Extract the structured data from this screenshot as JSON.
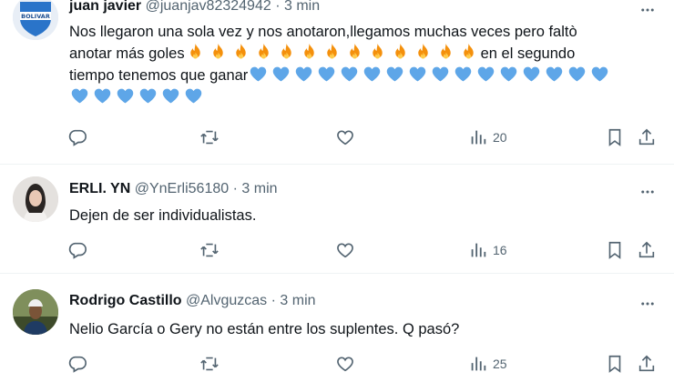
{
  "tweets": [
    {
      "name": "juan javier",
      "handle": "@juanjav82324942",
      "sep": "·",
      "time": "3 min",
      "text_1": "Nos llegaron una sola vez y nos anotaron,llegamos muchas veces pero faltò",
      "text_2": "anotar más goles",
      "text_2b": "en el segundo",
      "text_3": "tiempo tenemos que ganar",
      "fire_count": 13,
      "heart_count_line3": 16,
      "heart_count_line4": 6,
      "views": "20",
      "avatar_text": "BOLIVAR"
    },
    {
      "name": "ERLI. YN",
      "handle": "@YnErli56180",
      "sep": "·",
      "time": "3 min",
      "text": "Dejen de ser individualistas.",
      "views": "16"
    },
    {
      "name": "Rodrigo Castillo",
      "handle": "@Alvguzcas",
      "sep": "·",
      "time": "3 min",
      "text": "Nelio García o Gery no están entre los suplentes. Q pasó?",
      "views": "25"
    }
  ],
  "icons": {
    "reply": "reply-icon",
    "retweet": "retweet-icon",
    "like": "heart-icon",
    "views": "views-icon",
    "bookmark": "bookmark-icon",
    "share": "share-icon",
    "more": "more-icon"
  },
  "colors": {
    "text": "#0f1419",
    "muted": "#536471",
    "heart_emoji": "#5ea6e8",
    "fire_emoji": "#f4900c"
  }
}
